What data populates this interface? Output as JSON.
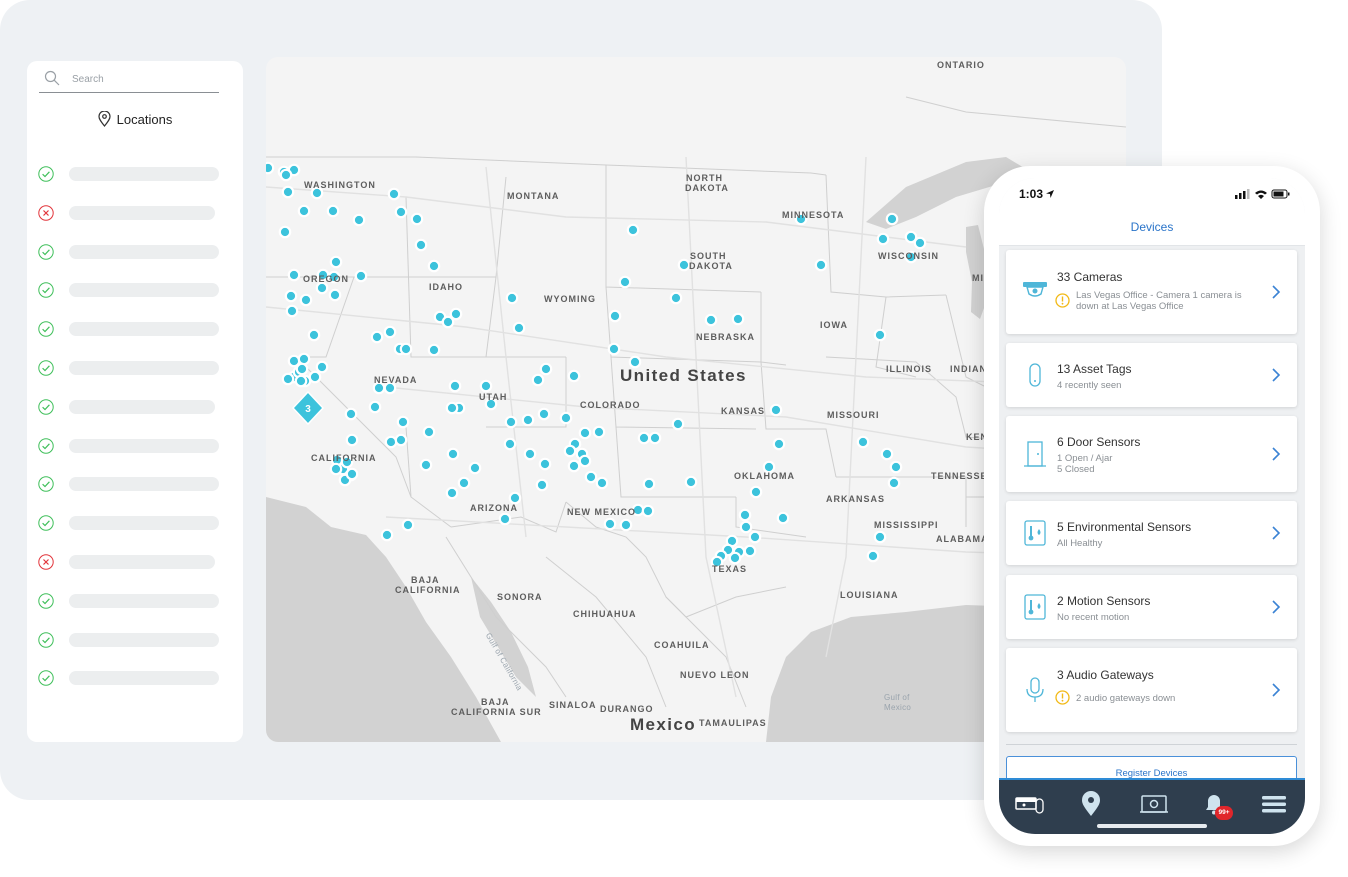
{
  "sidebar": {
    "search": {
      "placeholder": "Search"
    },
    "title": "Locations",
    "rows": [
      {
        "status": "ok"
      },
      {
        "status": "error"
      },
      {
        "status": "ok"
      },
      {
        "status": "ok"
      },
      {
        "status": "ok"
      },
      {
        "status": "ok"
      },
      {
        "status": "ok"
      },
      {
        "status": "ok"
      },
      {
        "status": "ok"
      },
      {
        "status": "ok"
      },
      {
        "status": "error"
      },
      {
        "status": "ok"
      },
      {
        "status": "ok"
      },
      {
        "status": "ok"
      }
    ]
  },
  "map": {
    "country": "United States",
    "country_south": "Mexico",
    "cluster_count": "3",
    "labels": {
      "ontario": "ONTARIO",
      "washington": "WASHINGTON",
      "montana": "MONTANA",
      "north_dakota_1": "NORTH",
      "north_dakota_2": "DAKOTA",
      "minnesota": "MINNESOTA",
      "wisconsin": "WISCONSIN",
      "mi": "MI",
      "oregon": "OREGON",
      "idaho": "IDAHO",
      "wyoming": "WYOMING",
      "south_dakota_1": "SOUTH",
      "south_dakota_2": "DAKOTA",
      "iowa": "IOWA",
      "nebraska": "NEBRASKA",
      "illinois": "ILLINOIS",
      "indiana": "INDIAN",
      "nevada": "NEVADA",
      "utah": "UTAH",
      "colorado": "COLORADO",
      "kansas": "KANSAS",
      "missouri": "MISSOURI",
      "kentucky": "KEN",
      "california": "CALIFORNIA",
      "tennessee": "TENNESSE",
      "oklahoma": "OKLAHOMA",
      "arkansas": "ARKANSAS",
      "arizona": "ARIZONA",
      "new_mexico": "NEW MEXICO",
      "texas": "TEXAS",
      "mississippi": "MISSISSIPPI",
      "alabama": "ALABAMA",
      "baja_california_1": "BAJA",
      "baja_california_2": "CALIFORNIA",
      "sonora": "SONORA",
      "chihuahua": "CHIHUAHUA",
      "louisiana": "LOUISIANA",
      "coahuila": "COAHUILA",
      "nuevo_leon": "NUEVO LEON",
      "baja_california_sur_1": "BAJA",
      "baja_california_sur_2": "CALIFORNIA SUR",
      "sinaloa": "SINALOA",
      "durango": "DURANGO",
      "tamaulipas": "TAMAULIPAS",
      "gulf_of_california": "Gulf of California",
      "gulf_of_mexico_1": "Gulf of",
      "gulf_of_mexico_2": "Mexico"
    },
    "marker_color": "#3cc3dc"
  },
  "phone": {
    "time": "1:03",
    "title": "Devices",
    "devices": [
      {
        "title": "33 Cameras",
        "subtitle": "Las Vegas Office - Camera 1 camera is down at Las Vegas Office",
        "icon": "camera-icon",
        "warning": true
      },
      {
        "title": "13 Asset Tags",
        "subtitle": "4 recently seen",
        "icon": "asset-tag-icon",
        "warning": false
      },
      {
        "title": "6 Door Sensors",
        "subtitle": "1 Open / Ajar",
        "subtitle2": "5 Closed",
        "icon": "door-sensor-icon",
        "warning": false
      },
      {
        "title": "5 Environmental Sensors",
        "subtitle": "All Healthy",
        "icon": "environmental-sensor-icon",
        "warning": false
      },
      {
        "title": "2 Motion Sensors",
        "subtitle": "No recent motion",
        "icon": "motion-sensor-icon",
        "warning": false
      },
      {
        "title": "3 Audio Gateways",
        "subtitle": "2 audio gateways down",
        "icon": "microphone-icon",
        "warning": true
      }
    ],
    "register_label": "Register Devices",
    "tabs": [
      "devices-tab",
      "locations-tab",
      "cameras-tab",
      "alerts-tab",
      "menu-tab"
    ],
    "badge": "99+",
    "accent": "#2a74c9"
  }
}
